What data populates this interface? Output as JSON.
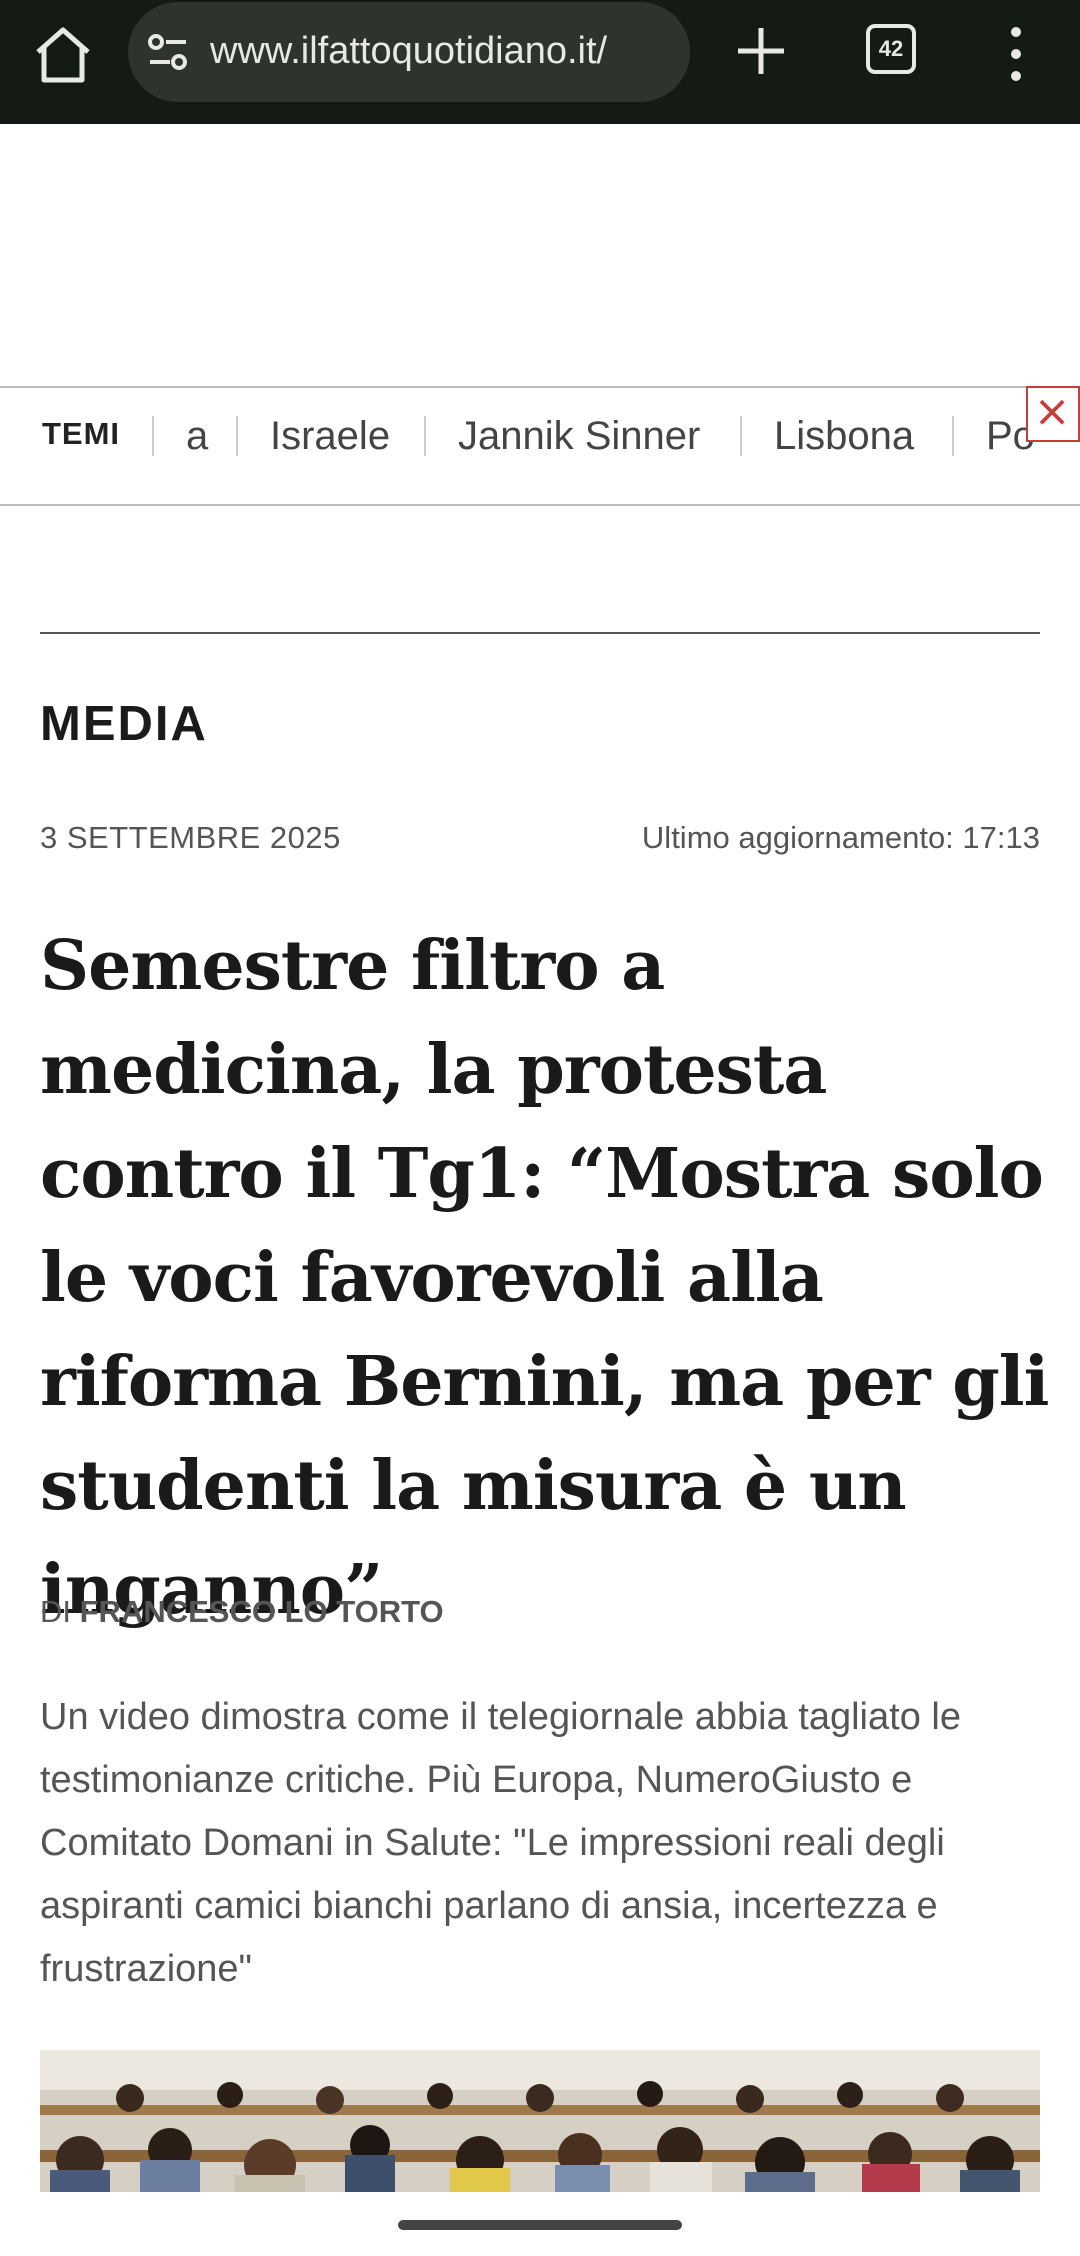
{
  "browser": {
    "url": "www.ilfattoquotidiano.it/",
    "tab_count": "42"
  },
  "topics": {
    "label": "TEMI",
    "items": [
      "a",
      "Israele",
      "Jannik Sinner",
      "Lisbona",
      "Po"
    ]
  },
  "article": {
    "section": "MEDIA",
    "date": "3 SETTEMBRE 2025",
    "updated": "Ultimo aggiornamento: 17:13",
    "headline": "Semestre filtro a medicina, la protesta contro il Tg1: “Mostra solo le voci favorevoli alla riforma Bernini, ma per gli studenti la misura è un inganno”",
    "byline_prefix": "DI",
    "author": "FRANCESCO LO TORTO",
    "summary": "Un video dimostra come il telegiornale abbia tagliato le testimonianze critiche. Più Europa, NumeroGiusto e Comitato Domani in Salute: \"Le impressioni reali degli aspiranti camici bianchi parlano di ansia, incertezza e frustrazione\""
  },
  "colors": {
    "topbar": "#141a14",
    "close_ad": "#c83c3c"
  },
  "icons": [
    "home-icon",
    "site-settings-icon",
    "new-tab-icon",
    "tab-switcher-icon",
    "more-menu-icon",
    "close-ad-icon"
  ]
}
